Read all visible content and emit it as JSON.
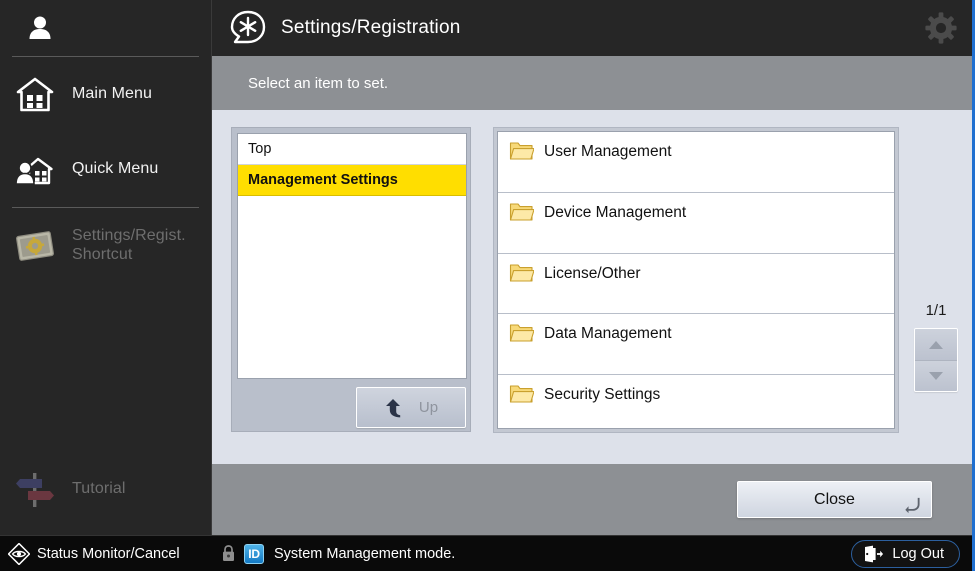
{
  "sidebar": {
    "user_icon": "user-icon",
    "items": [
      {
        "label": "Main Menu",
        "icon": "home-icon",
        "disabled": false
      },
      {
        "label": "Quick Menu",
        "icon": "quick-menu-icon",
        "disabled": false
      },
      {
        "label": "Settings/Regist.\nShortcut",
        "label_line1": "Settings/Regist.",
        "label_line2": "Shortcut",
        "icon": "settings-shortcut-icon",
        "disabled": true
      },
      {
        "label": "Tutorial",
        "icon": "signpost-icon",
        "disabled": true
      }
    ],
    "status_monitor": {
      "label": "Status Monitor/Cancel",
      "icon": "eye-diamond-icon"
    }
  },
  "header": {
    "icon": "asterisk-badge-icon",
    "title": "Settings/Registration",
    "gear_icon": "gear-icon"
  },
  "instruction": {
    "text": "Select an item to set."
  },
  "breadcrumb": {
    "items": [
      {
        "label": "Top",
        "selected": false
      },
      {
        "label": "Management Settings",
        "selected": true
      }
    ],
    "up_button": {
      "label": "Up",
      "icon": "arrow-up-left-icon",
      "disabled": true
    }
  },
  "folders": {
    "items": [
      {
        "label": "User Management",
        "icon": "folder-icon"
      },
      {
        "label": "Device Management",
        "icon": "folder-icon"
      },
      {
        "label": "License/Other",
        "icon": "folder-icon"
      },
      {
        "label": "Data Management",
        "icon": "folder-icon"
      },
      {
        "label": "Security Settings",
        "icon": "folder-icon"
      }
    ]
  },
  "pager": {
    "count": "1/1",
    "up_icon": "triangle-up-icon",
    "down_icon": "triangle-down-icon"
  },
  "actions": {
    "close_label": "Close",
    "close_return_icon": "return-arrow-icon"
  },
  "status": {
    "lock_icon": "lock-icon",
    "id_badge": "ID",
    "message": "System Management mode.",
    "logout_label": "Log Out",
    "logout_icon": "exit-door-icon"
  },
  "colors": {
    "accent_yellow": "#ffde00",
    "panel_bg": "#dde1ea",
    "bar_gray": "#8d9094",
    "dark": "#262626",
    "blue_border": "#1f6fd0",
    "folder_yellow": "#f5cf56"
  }
}
